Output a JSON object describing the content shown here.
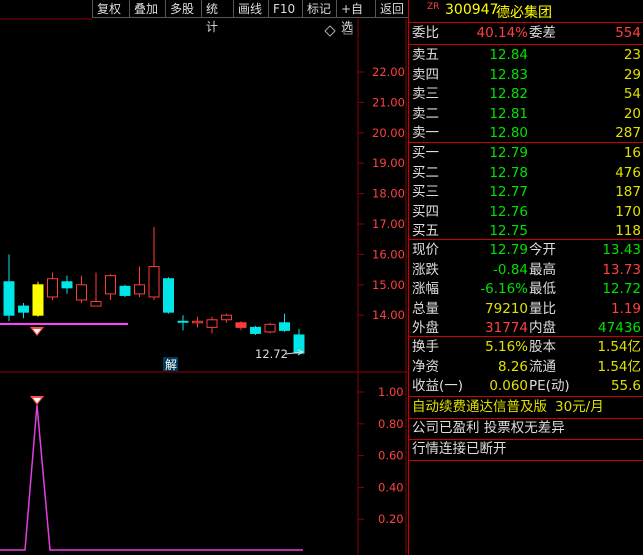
{
  "toolbar": [
    "复权",
    "叠加",
    "多股",
    "统计",
    "画线",
    "F10",
    "标记",
    "+自选",
    "返回"
  ],
  "price_axis": [
    "22.00",
    "21.00",
    "20.00",
    "19.00",
    "18.00",
    "17.00",
    "16.00",
    "15.00",
    "14.00"
  ],
  "indicator_axis": [
    "1.00",
    "0.80",
    "0.60",
    "0.40",
    "0.20"
  ],
  "chart": {
    "low_label": "12.72",
    "jie_label": "解"
  },
  "candles": [
    {
      "o": 14.0,
      "c": 15.1,
      "h": 16.0,
      "l": 13.8,
      "color": "cyan"
    },
    {
      "o": 14.3,
      "c": 14.1,
      "h": 14.4,
      "l": 13.9,
      "color": "cyan"
    },
    {
      "o": 14.0,
      "c": 15.0,
      "h": 15.1,
      "l": 13.95,
      "color": "yellow"
    },
    {
      "o": 14.6,
      "c": 15.2,
      "h": 15.4,
      "l": 14.5,
      "color": "red"
    },
    {
      "o": 15.1,
      "c": 14.9,
      "h": 15.3,
      "l": 14.7,
      "color": "cyan"
    },
    {
      "o": 14.5,
      "c": 15.0,
      "h": 15.3,
      "l": 14.4,
      "color": "red"
    },
    {
      "o": 14.3,
      "c": 14.45,
      "h": 15.4,
      "l": 14.3,
      "color": "red"
    },
    {
      "o": 14.7,
      "c": 15.3,
      "h": 15.35,
      "l": 14.5,
      "color": "red"
    },
    {
      "o": 14.95,
      "c": 14.65,
      "h": 15.0,
      "l": 14.6,
      "color": "cyan"
    },
    {
      "o": 14.7,
      "c": 15.0,
      "h": 15.6,
      "l": 14.6,
      "color": "red"
    },
    {
      "o": 14.6,
      "c": 15.6,
      "h": 16.9,
      "l": 14.5,
      "color": "red"
    },
    {
      "o": 15.2,
      "c": 14.1,
      "h": 15.25,
      "l": 14.05,
      "color": "cyan"
    },
    {
      "o": 13.8,
      "c": 13.8,
      "h": 14.0,
      "l": 13.5,
      "color": "cyan"
    },
    {
      "o": 13.75,
      "c": 13.8,
      "h": 13.95,
      "l": 13.6,
      "color": "red"
    },
    {
      "o": 13.6,
      "c": 13.85,
      "h": 13.95,
      "l": 13.4,
      "color": "red"
    },
    {
      "o": 13.85,
      "c": 14.0,
      "h": 14.05,
      "l": 13.75,
      "color": "red"
    },
    {
      "o": 13.75,
      "c": 13.6,
      "h": 13.8,
      "l": 13.5,
      "color": "red"
    },
    {
      "o": 13.6,
      "c": 13.4,
      "h": 13.65,
      "l": 13.35,
      "color": "cyan"
    },
    {
      "o": 13.45,
      "c": 13.7,
      "h": 13.75,
      "l": 13.4,
      "color": "red"
    },
    {
      "o": 13.75,
      "c": 13.5,
      "h": 14.05,
      "l": 13.45,
      "color": "cyan"
    },
    {
      "o": 13.35,
      "c": 12.75,
      "h": 13.55,
      "l": 12.72,
      "color": "cyan"
    }
  ],
  "quote": {
    "code": "300947",
    "name": "德必集团",
    "tag": "ZR",
    "weibi_label": "委比",
    "weibi": "40.14%",
    "weicha_label": "委差",
    "weicha": "554",
    "asks": [
      {
        "label": "卖五",
        "price": "12.84",
        "vol": "23"
      },
      {
        "label": "卖四",
        "price": "12.83",
        "vol": "29"
      },
      {
        "label": "卖三",
        "price": "12.82",
        "vol": "54"
      },
      {
        "label": "卖二",
        "price": "12.81",
        "vol": "20"
      },
      {
        "label": "卖一",
        "price": "12.80",
        "vol": "287"
      }
    ],
    "bids": [
      {
        "label": "买一",
        "price": "12.79",
        "vol": "16"
      },
      {
        "label": "买二",
        "price": "12.78",
        "vol": "476"
      },
      {
        "label": "买三",
        "price": "12.77",
        "vol": "187"
      },
      {
        "label": "买四",
        "price": "12.76",
        "vol": "170"
      },
      {
        "label": "买五",
        "price": "12.75",
        "vol": "118"
      }
    ],
    "stats": [
      {
        "l1": "现价",
        "v1": "12.79",
        "c1": "green",
        "l2": "今开",
        "v2": "13.43",
        "c2": "green"
      },
      {
        "l1": "涨跌",
        "v1": "-0.84",
        "c1": "green",
        "l2": "最高",
        "v2": "13.73",
        "c2": "red"
      },
      {
        "l1": "涨幅",
        "v1": "-6.16%",
        "c1": "green",
        "l2": "最低",
        "v2": "12.72",
        "c2": "green"
      },
      {
        "l1": "总量",
        "v1": "79210",
        "c1": "yellow",
        "l2": "量比",
        "v2": "1.19",
        "c2": "red"
      },
      {
        "l1": "外盘",
        "v1": "31774",
        "c1": "red",
        "l2": "内盘",
        "v2": "47436",
        "c2": "green"
      }
    ],
    "stats2": [
      {
        "l1": "换手",
        "v1": "5.16%",
        "l2": "股本",
        "v2": "1.54亿"
      },
      {
        "l1": "净资",
        "v1": "8.26",
        "l2": "流通",
        "v2": "1.54亿"
      },
      {
        "l1": "收益(一)",
        "v1": "0.060",
        "l2": "PE(动)",
        "v2": "55.6"
      }
    ],
    "ad_text": "自动续费通达信普及版",
    "ad_price": "30元/月",
    "notice1": "公司已盈利 投票权无差异",
    "notice2": "行情连接已断开"
  },
  "colors": {
    "up": "#ff3c3c",
    "down": "#00e0e0",
    "yellow": "#ffff00",
    "magenta": "#ff00ff",
    "grid": "#8b0000"
  }
}
